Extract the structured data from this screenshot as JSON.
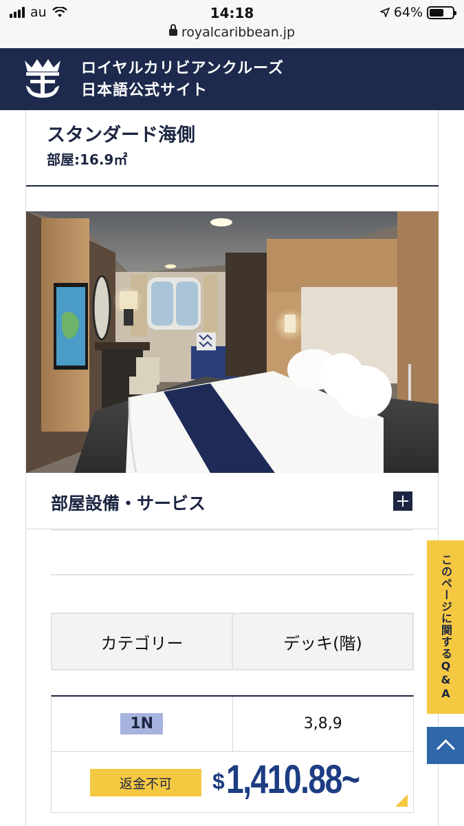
{
  "status_bar": {
    "carrier": "au",
    "time": "14:18",
    "battery": "64%",
    "battery_level": 0.64,
    "url": "royalcaribbean.jp"
  },
  "header": {
    "brand_line1": "ロイヤルカリビアンクルーズ",
    "brand_line2": "日本語公式サイト"
  },
  "room": {
    "title": "スタンダード海側",
    "size": "部屋:16.9㎡"
  },
  "amenities": {
    "label": "部屋設備・サービス"
  },
  "table": {
    "headers": [
      "カテゴリー",
      "デッキ(階)"
    ],
    "category": "1N",
    "decks": "3,8,9",
    "nonrefundable_label": "返金不可",
    "price_currency": "$",
    "price_amount": "1,410.88~"
  },
  "side_tab": {
    "qa_label": "このページに関するQ&A"
  },
  "colors": {
    "navy": "#1d2a4d",
    "yellow": "#f5c842",
    "price_blue": "#1d3d83",
    "badge": "#a6b3de",
    "scroll_top": "#2f67a8"
  }
}
